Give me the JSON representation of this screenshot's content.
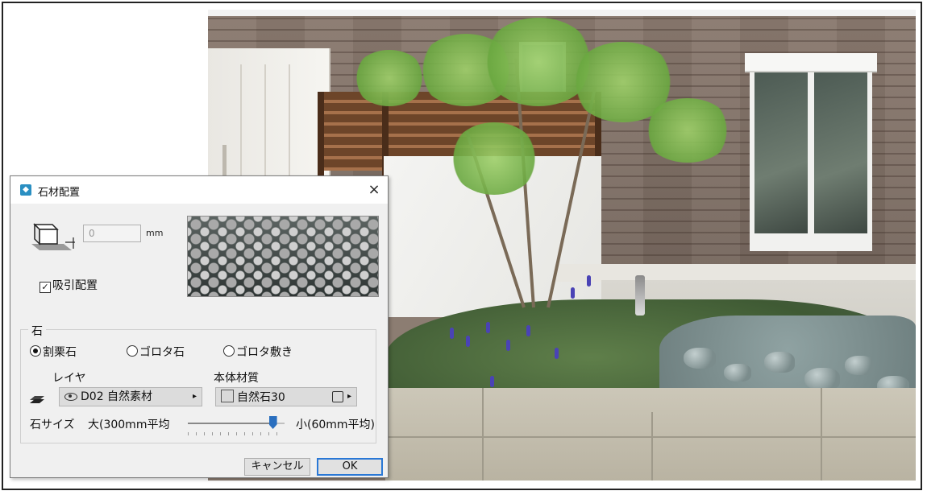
{
  "dialog": {
    "title": "石材配置",
    "close_glyph": "×",
    "height_value": "0",
    "height_unit": "mm",
    "suction_checkbox": {
      "label": "吸引配置",
      "checked": true,
      "mark": "✓"
    },
    "stone_group": {
      "label": "石",
      "options": [
        {
          "label": "割栗石",
          "selected": true
        },
        {
          "label": "ゴロタ石",
          "selected": false
        },
        {
          "label": "ゴロタ敷き",
          "selected": false
        }
      ]
    },
    "layer": {
      "label": "レイヤ",
      "value": "D02 自然素材",
      "arrow": "▸"
    },
    "material": {
      "label": "本体材質",
      "value": "自然石30",
      "arrow": "▸"
    },
    "stone_size": {
      "label": "石サイズ",
      "min_label": "大(300mm平均",
      "max_label": "小(60mm平均)",
      "level": 0.88
    },
    "buttons": {
      "cancel": "キャンセル",
      "ok": "OK"
    }
  },
  "colors": {
    "accent": "#2a6fbf",
    "dialog_bg": "#f0f0f0",
    "title_icon": "#2a8fc2"
  },
  "icons": [
    "stone-dialog-icon",
    "block-height-icon",
    "eye-icon",
    "layer-stack-icon",
    "material-swatch-icon",
    "material-picker-icon",
    "close-icon"
  ]
}
